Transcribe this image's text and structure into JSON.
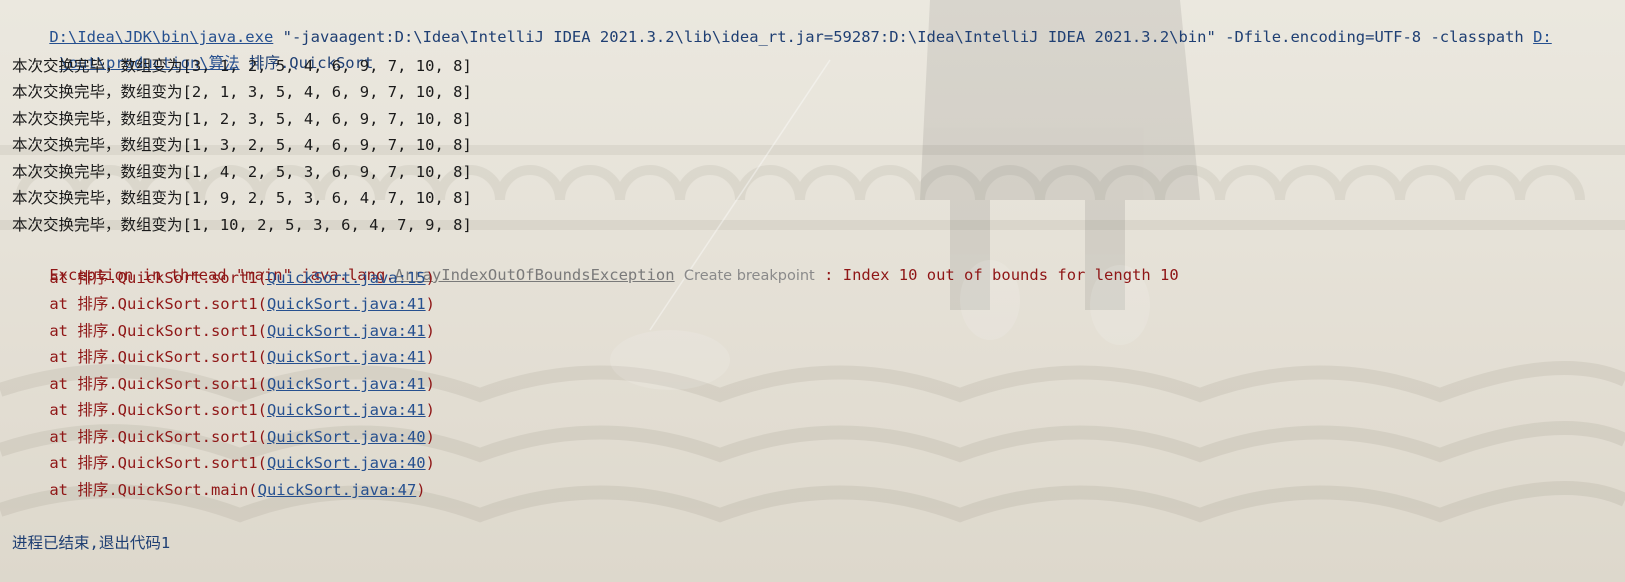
{
  "command": {
    "exe_path": "D:\\Idea\\JDK\\bin\\java.exe",
    "args": " \"-javaagent:D:\\Idea\\IntelliJ IDEA 2021.3.2\\lib\\idea_rt.jar=59287:D:\\Idea\\IntelliJ IDEA 2021.3.2\\bin\" -Dfile.encoding=UTF-8 -classpath ",
    "classpath_tail": "D:",
    "classpath_cont": "\\out\\production\\算法",
    "main_class": " 排序.QuickSort"
  },
  "output_lines": [
    "本次交换完毕，数组变为[3, 1, 2, 5, 4, 6, 9, 7, 10, 8]",
    "本次交换完毕，数组变为[2, 1, 3, 5, 4, 6, 9, 7, 10, 8]",
    "本次交换完毕，数组变为[1, 2, 3, 5, 4, 6, 9, 7, 10, 8]",
    "本次交换完毕，数组变为[1, 3, 2, 5, 4, 6, 9, 7, 10, 8]",
    "本次交换完毕，数组变为[1, 4, 2, 5, 3, 6, 9, 7, 10, 8]",
    "本次交换完毕，数组变为[1, 9, 2, 5, 3, 6, 4, 7, 10, 8]",
    "本次交换完毕，数组变为[1, 10, 2, 5, 3, 6, 4, 7, 9, 8]"
  ],
  "exception": {
    "prefix": "Exception in thread \"main\" java.lang.",
    "class_name": "ArrayIndexOutOfBoundsException",
    "create_breakpoint": "Create breakpoint",
    "message": " : Index 10 out of bounds for length 10"
  },
  "stack": [
    {
      "prefix": "    at 排序.QuickSort.sort1(",
      "link": "QuickSort.java:15",
      "suffix": ")"
    },
    {
      "prefix": "    at 排序.QuickSort.sort1(",
      "link": "QuickSort.java:41",
      "suffix": ")"
    },
    {
      "prefix": "    at 排序.QuickSort.sort1(",
      "link": "QuickSort.java:41",
      "suffix": ")"
    },
    {
      "prefix": "    at 排序.QuickSort.sort1(",
      "link": "QuickSort.java:41",
      "suffix": ")"
    },
    {
      "prefix": "    at 排序.QuickSort.sort1(",
      "link": "QuickSort.java:41",
      "suffix": ")"
    },
    {
      "prefix": "    at 排序.QuickSort.sort1(",
      "link": "QuickSort.java:41",
      "suffix": ")"
    },
    {
      "prefix": "    at 排序.QuickSort.sort1(",
      "link": "QuickSort.java:40",
      "suffix": ")"
    },
    {
      "prefix": "    at 排序.QuickSort.sort1(",
      "link": "QuickSort.java:40",
      "suffix": ")"
    },
    {
      "prefix": "    at 排序.QuickSort.main(",
      "link": "QuickSort.java:47",
      "suffix": ")"
    }
  ],
  "exit_message": "进程已结束,退出代码1",
  "colors": {
    "command": "#1f3f73",
    "link": "#26508f",
    "output": "#1a1a1a",
    "error": "#8f1616",
    "hint": "#8a8a8a"
  }
}
